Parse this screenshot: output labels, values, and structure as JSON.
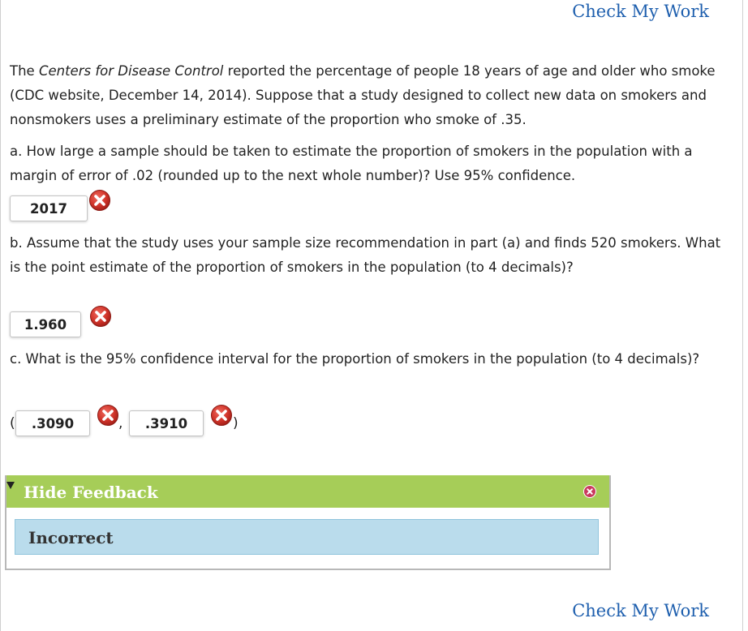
{
  "links": {
    "check_my_work_top": "Check My Work",
    "check_my_work_bottom": "Check My Work"
  },
  "intro": {
    "before": "The ",
    "italic": "Centers for Disease Control",
    "after": " reported the percentage of people 18 years of age and older who smoke (CDC website, December 14, 2014). Suppose that a study designed to collect new data on smokers and nonsmokers uses a preliminary estimate of the proportion who smoke of .35."
  },
  "part_a": {
    "question": "a. How large a sample should be taken to estimate the proportion of smokers in the population with a margin of error of .02 (rounded up to the next whole number)? Use 95% confidence.",
    "answer": "2017",
    "status": "incorrect"
  },
  "part_b": {
    "question": "b. Assume that the study uses your sample size recommendation in part (a) and finds 520 smokers. What is the point estimate of the proportion of smokers in the population (to 4 decimals)?",
    "answer": "1.960",
    "status": "incorrect"
  },
  "part_c": {
    "question": "c. What is the 95% confidence interval for the proportion of smokers in the population (to 4 decimals)?",
    "open_paren": "(",
    "separator": ",",
    "close_paren": ")",
    "lower_answer": ".3090",
    "upper_answer": ".3910",
    "lower_status": "incorrect",
    "upper_status": "incorrect"
  },
  "feedback": {
    "toggle_label": "Hide Feedback",
    "result": "Incorrect"
  },
  "colors": {
    "link": "#1e5fae",
    "feedback_bar": "#a6cd58",
    "feedback_body": "#badcec",
    "error_icon": "#c0281f"
  },
  "icons": {
    "incorrect": "x-circle-icon",
    "close": "close-icon",
    "toggle": "triangle-down-icon"
  }
}
